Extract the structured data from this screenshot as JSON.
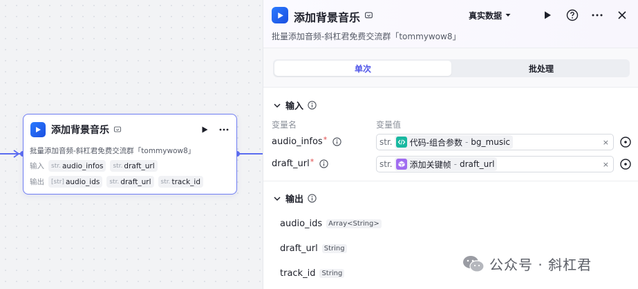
{
  "node": {
    "title": "添加背景音乐",
    "description": "批量添加音频-斜杠君免费交流群「tommywow8」",
    "input_label": "输入",
    "output_label": "输出",
    "inputs": [
      {
        "type": "str.",
        "name": "audio_infos"
      },
      {
        "type": "str.",
        "name": "draft_url"
      }
    ],
    "outputs": [
      {
        "type": "[str]",
        "name": "audio_ids"
      },
      {
        "type": "str.",
        "name": "draft_url"
      },
      {
        "type": "str.",
        "name": "track_id"
      }
    ]
  },
  "panel": {
    "title": "添加背景音乐",
    "description": "批量添加音频-斜杠君免费交流群「tommywow8」",
    "data_mode": "真实数据",
    "tabs": [
      {
        "label": "单次",
        "active": true
      },
      {
        "label": "批处理",
        "active": false
      }
    ],
    "input_section": "输入",
    "col_name": "变量名",
    "col_value": "变量值",
    "params": [
      {
        "name": "audio_infos",
        "required": "*",
        "type": "str.",
        "node_ref": "代码-组合参数",
        "sep": "-",
        "var": "bg_music",
        "clear": "×"
      },
      {
        "name": "draft_url",
        "required": "*",
        "type": "str.",
        "node_ref": "添加关键帧",
        "sep": "-",
        "var": "draft_url",
        "clear": "×"
      }
    ],
    "output_section": "输出",
    "outputs": [
      {
        "name": "audio_ids",
        "type": "Array<String>"
      },
      {
        "name": "draft_url",
        "type": "String"
      },
      {
        "name": "track_id",
        "type": "String"
      }
    ]
  },
  "watermark": {
    "text": "公众号 · 斜杠君"
  },
  "colors": {
    "accent": "#4d53e8",
    "edge": "#5b6cf0",
    "brand_blue": "#2b7bff",
    "code_green": "#18b8a0",
    "keyframe_purple": "#a06cf0"
  }
}
